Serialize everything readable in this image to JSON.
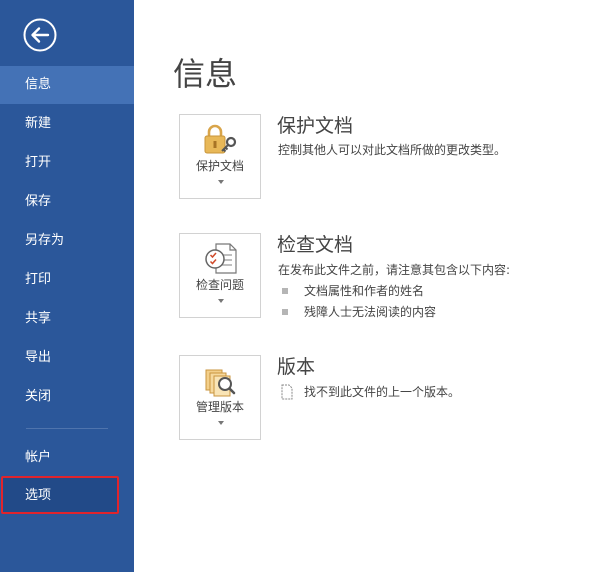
{
  "sidebar": {
    "items": [
      {
        "label": "信息"
      },
      {
        "label": "新建"
      },
      {
        "label": "打开"
      },
      {
        "label": "保存"
      },
      {
        "label": "另存为"
      },
      {
        "label": "打印"
      },
      {
        "label": "共享"
      },
      {
        "label": "导出"
      },
      {
        "label": "关闭"
      },
      {
        "label": "帐户"
      },
      {
        "label": "选项"
      }
    ]
  },
  "main": {
    "title": "信息",
    "protect": {
      "button_label": "保护文档",
      "title": "保护文档",
      "description": "控制其他人可以对此文档所做的更改类型。"
    },
    "inspect": {
      "button_label": "检查问题",
      "title": "检查文档",
      "description": "在发布此文件之前，请注意其包含以下内容:",
      "bullets": [
        "文档属性和作者的姓名",
        "残障人士无法阅读的内容"
      ]
    },
    "versions": {
      "button_label": "管理版本",
      "title": "版本",
      "description": "找不到此文件的上一个版本。"
    }
  },
  "colors": {
    "sidebar_bg": "#2b579a",
    "active_item": "#4472b6",
    "highlight_border": "#e0242c"
  }
}
